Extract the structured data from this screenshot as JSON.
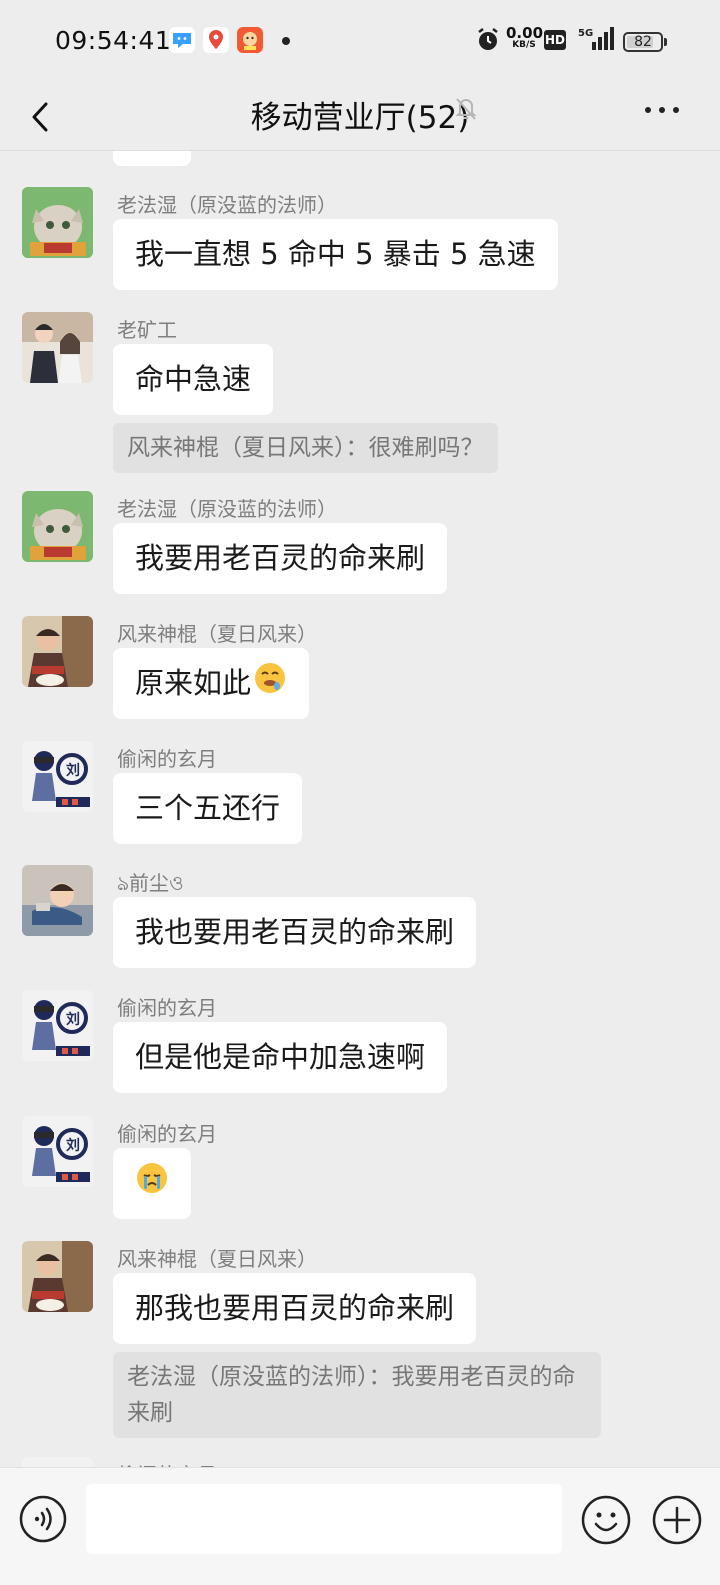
{
  "status_bar": {
    "time": "09:54:41",
    "net_speed_value": "0.00",
    "net_speed_unit": "KB/S",
    "hd_label": "HD",
    "signal_label": "5G",
    "battery": "82",
    "battery_level": 0.82
  },
  "header": {
    "title": "移动营业厅(52)"
  },
  "messages": [
    {
      "sender": "老法湿（原没蓝的法师）",
      "text": "我一直想 5 命中 5 暴击 5 急速"
    },
    {
      "sender": "老矿工",
      "text": "命中急速",
      "quote": "风来神棍（夏日风来）：很难刷吗？"
    },
    {
      "sender": "老法湿（原没蓝的法师）",
      "text": "我要用老百灵的命来刷"
    },
    {
      "sender": "风来神棍（夏日风来）",
      "text": "原来如此"
    },
    {
      "sender": "偷闲的玄月",
      "text": "三个五还行"
    },
    {
      "sender": "ঌ前尘ও",
      "text": "我也要用老百灵的命来刷"
    },
    {
      "sender": "偷闲的玄月",
      "text": "但是他是命中加急速啊"
    },
    {
      "sender": "偷闲的玄月",
      "text": ""
    },
    {
      "sender": "风来神棍（夏日风来）",
      "text": "那我也要用百灵的命来刷",
      "quote": "老法湿（原没蓝的法师）：我要用老百灵的命来刷"
    }
  ],
  "partial_sender": "偷闲的玄月",
  "icons": {
    "back": "chevron-left-icon",
    "mute": "bell-off-icon",
    "more": "more-dots-icon",
    "voice": "voice-icon",
    "emoji": "emoji-icon",
    "plus": "plus-icon"
  }
}
